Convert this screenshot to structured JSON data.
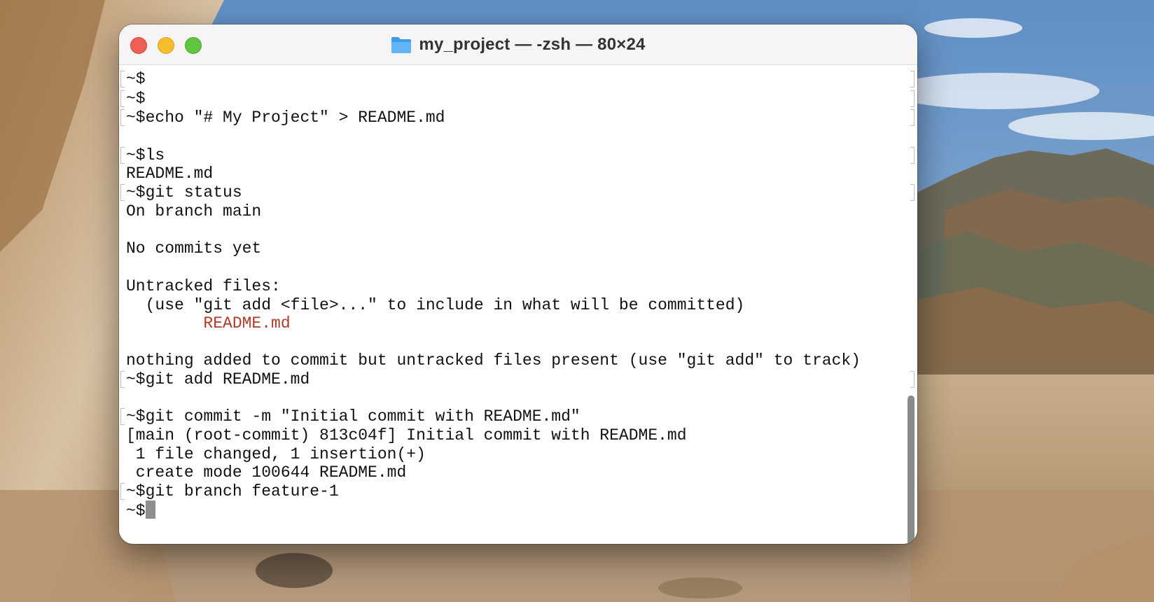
{
  "window": {
    "title": "my_project — -zsh — 80×24"
  },
  "icons": {
    "close": "close-button",
    "minimize": "minimize-button",
    "maximize": "zoom-button",
    "folder": "folder-icon",
    "cursor": "block-cursor"
  },
  "colors": {
    "close": "#ee5f57",
    "minimize": "#f6bd2f",
    "maximize": "#60c53f",
    "untracked_file": "#b23a2a",
    "cursor": "#8e8e8e"
  },
  "terminal": {
    "lines": [
      "~$",
      "~$",
      "~$echo \"# My Project\" > README.md",
      "",
      "~$ls",
      "README.md",
      "~$git status",
      "On branch main",
      "",
      "No commits yet",
      "",
      "Untracked files:",
      "  (use \"git add <file>...\" to include in what will be committed)",
      "        README.md",
      "",
      "nothing added to commit but untracked files present (use \"git add\" to track)",
      "~$git add README.md",
      "",
      "~$git commit -m \"Initial commit with README.md\"",
      "[main (root-commit) 813c04f] Initial commit with README.md",
      " 1 file changed, 1 insertion(+)",
      " create mode 100644 README.md",
      "~$git branch feature-1",
      "~$"
    ]
  }
}
